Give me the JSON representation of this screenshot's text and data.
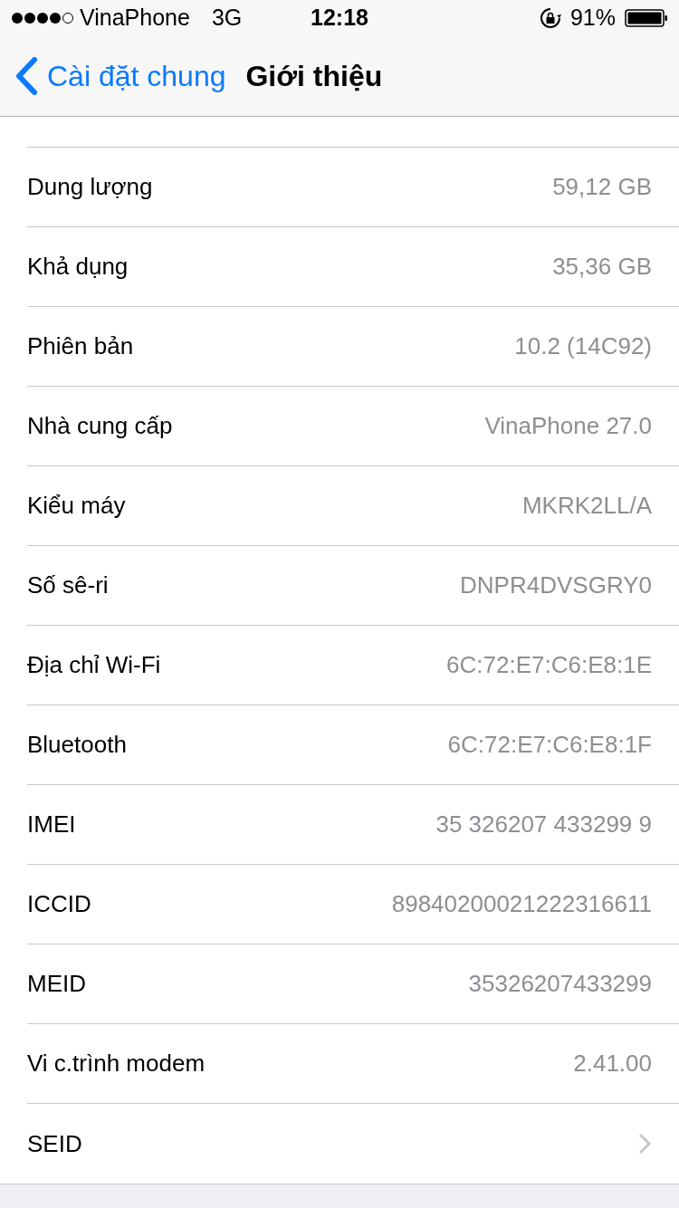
{
  "status_bar": {
    "carrier": "VinaPhone",
    "network": "3G",
    "time": "12:18",
    "battery_percent": "91%"
  },
  "nav_bar": {
    "back_label": "Cài đặt chung",
    "title": "Giới thiệu"
  },
  "rows": [
    {
      "kind": "value",
      "label": "Dung lượng",
      "value": "59,12 GB"
    },
    {
      "kind": "value",
      "label": "Khả dụng",
      "value": "35,36 GB"
    },
    {
      "kind": "value",
      "label": "Phiên bản",
      "value": "10.2 (14C92)"
    },
    {
      "kind": "value",
      "label": "Nhà cung cấp",
      "value": "VinaPhone 27.0"
    },
    {
      "kind": "value",
      "label": "Kiểu máy",
      "value": "MKRK2LL/A"
    },
    {
      "kind": "value",
      "label": "Số sê-ri",
      "value": "DNPR4DVSGRY0"
    },
    {
      "kind": "value",
      "label": "Địa chỉ Wi-Fi",
      "value": "6C:72:E7:C6:E8:1E"
    },
    {
      "kind": "value",
      "label": "Bluetooth",
      "value": "6C:72:E7:C6:E8:1F"
    },
    {
      "kind": "value",
      "label": "IMEI",
      "value": "35 326207 433299 9"
    },
    {
      "kind": "value",
      "label": "ICCID",
      "value": "89840200021222316611"
    },
    {
      "kind": "value",
      "label": "MEID",
      "value": "35326207433299"
    },
    {
      "kind": "value",
      "label": "Vi c.trình modem",
      "value": "2.41.00"
    },
    {
      "kind": "disclosure",
      "label": "SEID"
    }
  ]
}
